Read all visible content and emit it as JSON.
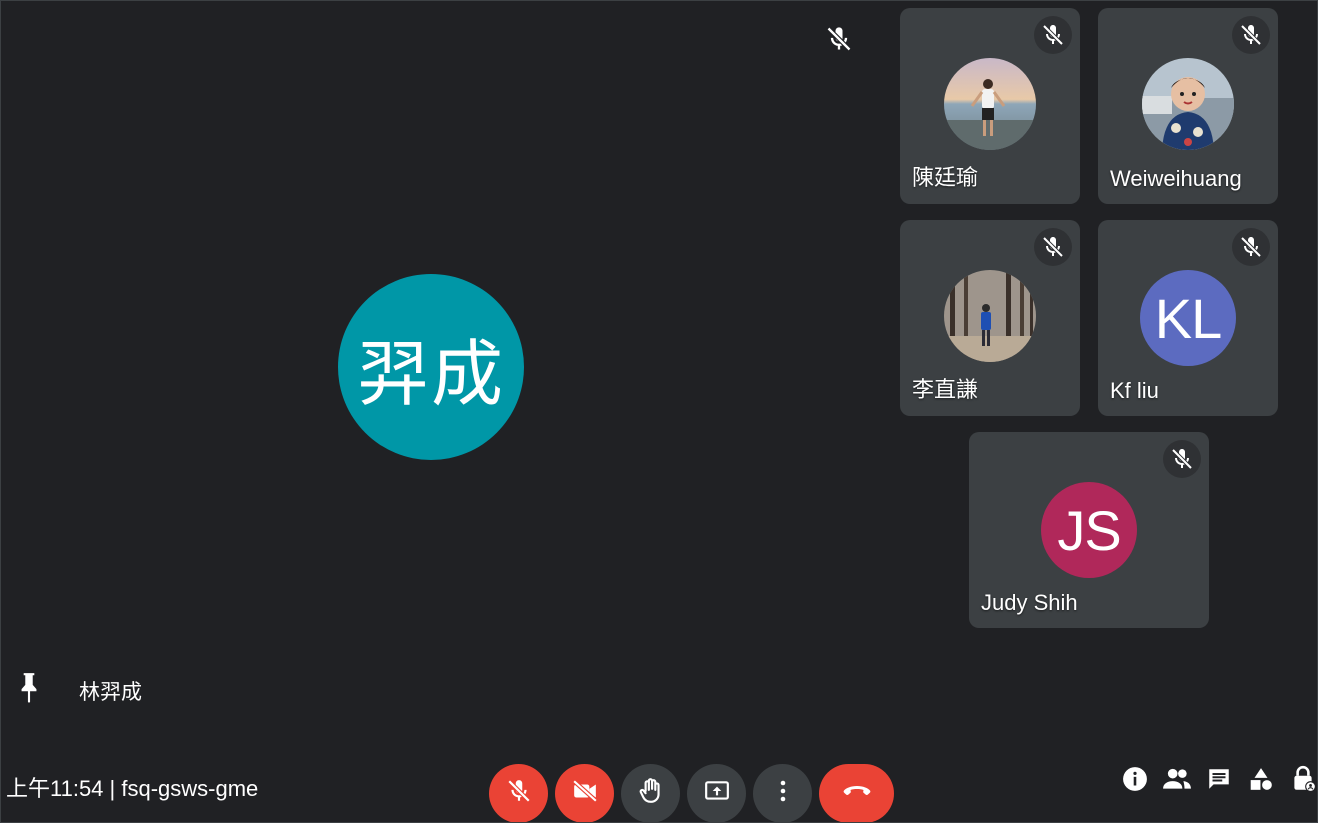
{
  "main": {
    "avatar_text": "羿成",
    "avatar_color": "#0097a7",
    "pinned_name": "林羿成",
    "muted": true
  },
  "participants": [
    {
      "name": "陳廷瑜",
      "type": "photo",
      "muted": true
    },
    {
      "name": "Weiweihuang",
      "type": "photo",
      "muted": true
    },
    {
      "name": "李直謙",
      "type": "photo",
      "muted": true
    },
    {
      "name": "Kf liu",
      "type": "initials",
      "initials": "KL",
      "color": "#5c6bc0",
      "muted": true
    },
    {
      "name": "Judy Shih",
      "type": "initials",
      "initials": "JS",
      "color": "#b0285a",
      "muted": true
    }
  ],
  "meeting": {
    "info": "上午11:54 | fsq-gsws-gme"
  },
  "controls": [
    {
      "name": "mic-off-icon",
      "state": "off",
      "color": "#ea4335"
    },
    {
      "name": "camera-off-icon",
      "state": "off",
      "color": "#ea4335"
    },
    {
      "name": "raise-hand-icon",
      "color": "#3c4043"
    },
    {
      "name": "present-screen-icon",
      "color": "#3c4043"
    },
    {
      "name": "more-options-icon",
      "color": "#3c4043"
    },
    {
      "name": "hang-up-icon",
      "color": "#ea4335"
    }
  ],
  "right_icons": [
    "info-icon",
    "people-icon",
    "chat-icon",
    "activities-icon",
    "host-controls-icon"
  ]
}
